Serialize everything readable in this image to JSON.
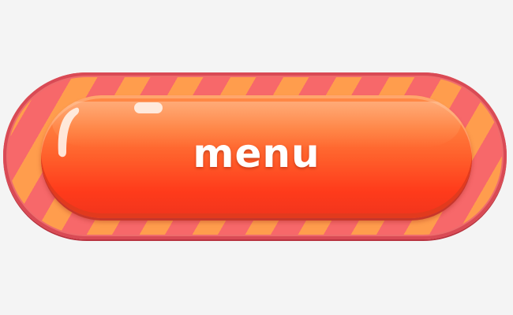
{
  "button": {
    "label": "menu"
  },
  "colors": {
    "background": "#f4f4f4",
    "stripe_red": "#f7686a",
    "stripe_orange": "#ff9d4d",
    "button_top": "#ff8a47",
    "button_bottom": "#f0341c",
    "text": "#ffffff"
  }
}
